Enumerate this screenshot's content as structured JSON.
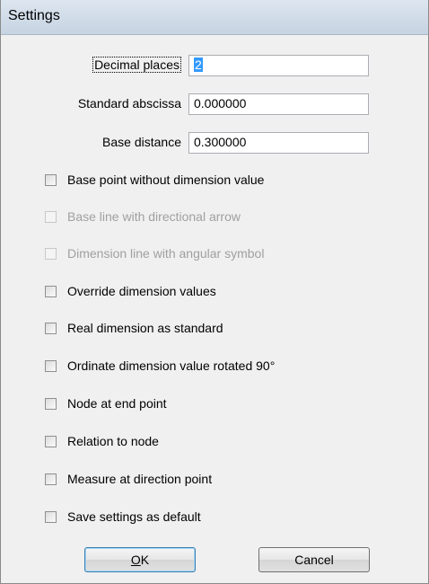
{
  "window": {
    "title": "Settings"
  },
  "fields": [
    {
      "label": "Decimal places",
      "value": "2"
    },
    {
      "label": "Standard abscissa",
      "value": "0.000000"
    },
    {
      "label": "Base distance",
      "value": "0.300000"
    }
  ],
  "checkboxes": [
    {
      "label": "Base point without dimension value",
      "checked": false,
      "enabled": true
    },
    {
      "label": "Base line with directional arrow",
      "checked": false,
      "enabled": false
    },
    {
      "label": "Dimension line with angular symbol",
      "checked": false,
      "enabled": false
    },
    {
      "label": "Override dimension values",
      "checked": false,
      "enabled": true
    },
    {
      "label": "Real dimension as standard",
      "checked": false,
      "enabled": true
    },
    {
      "label": "Ordinate dimension value rotated 90°",
      "checked": false,
      "enabled": true
    },
    {
      "label": "Node at end point",
      "checked": false,
      "enabled": true
    },
    {
      "label": "Relation to node",
      "checked": false,
      "enabled": true
    },
    {
      "label": "Measure at direction point",
      "checked": false,
      "enabled": true
    },
    {
      "label": "Save settings as default",
      "checked": false,
      "enabled": true
    }
  ],
  "buttons": {
    "ok": {
      "mnemonic": "O",
      "rest": "K"
    },
    "cancel": "Cancel"
  }
}
